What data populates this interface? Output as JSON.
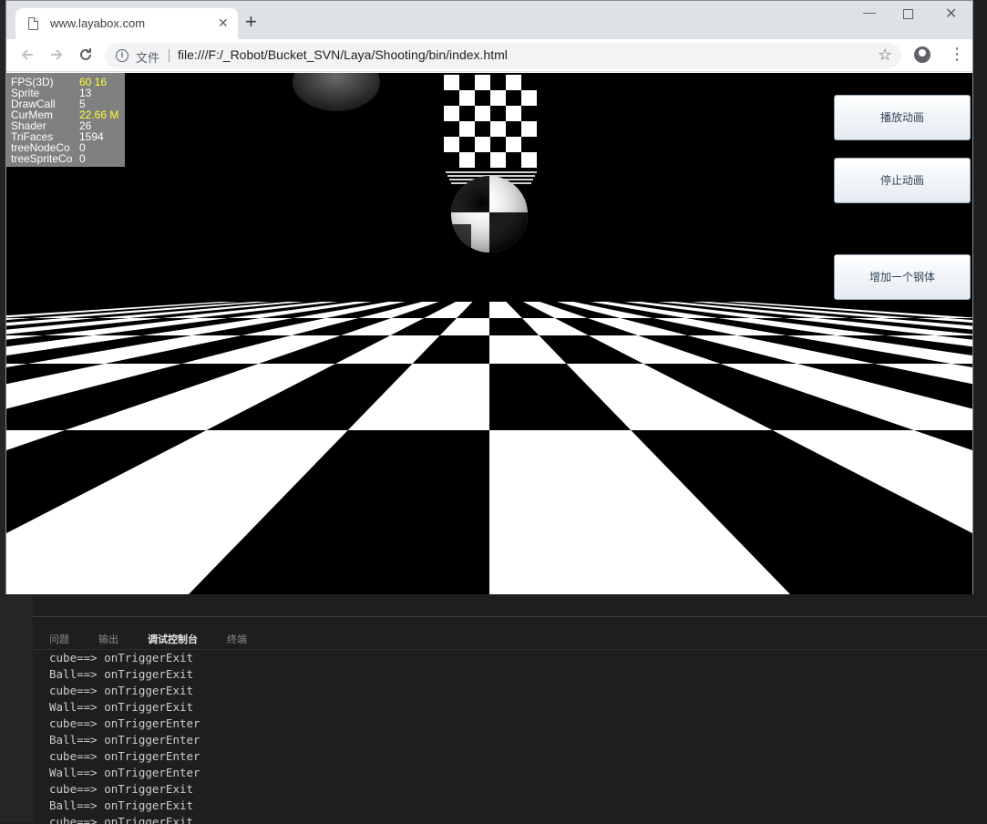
{
  "browser": {
    "tab_title": "www.layabox.com",
    "tab_close": "✕",
    "new_tab": "+",
    "address": {
      "security_label": "文件",
      "url": "file:///F:/_Robot/Bucket_SVN/Laya/Shooting/bin/index.html"
    },
    "icons": {
      "back": "arrow-left-icon",
      "forward": "arrow-right-icon",
      "reload": "reload-icon",
      "star": "star-icon",
      "profile": "account-icon",
      "menu": "menu-dots-icon"
    }
  },
  "stats": [
    {
      "label": "FPS(3D)",
      "value": "60 16",
      "highlight": true
    },
    {
      "label": "Sprite",
      "value": "13",
      "highlight": false
    },
    {
      "label": "DrawCall",
      "value": "5",
      "highlight": false
    },
    {
      "label": "CurMem",
      "value": "22.66 M",
      "highlight": true
    },
    {
      "label": "Shader",
      "value": "26",
      "highlight": false
    },
    {
      "label": "TriFaces",
      "value": "1594",
      "highlight": false
    },
    {
      "label": "treeNodeCo",
      "value": "0",
      "highlight": false
    },
    {
      "label": "treeSpriteCo",
      "value": "0",
      "highlight": false
    }
  ],
  "buttons": {
    "play": "播放动画",
    "stop": "停止动画",
    "add_body": "增加一个钢体"
  },
  "panel": {
    "tabs": [
      "问题",
      "输出",
      "调试控制台",
      "终端"
    ],
    "active_tab": "调试控制台",
    "console": [
      "cube==> onTriggerExit",
      "Ball==> onTriggerExit",
      "cube==> onTriggerExit",
      "Wall==> onTriggerExit",
      "cube==> onTriggerEnter",
      "Ball==> onTriggerEnter",
      "cube==> onTriggerEnter",
      "Wall==> onTriggerEnter",
      "cube==> onTriggerExit",
      "Ball==> onTriggerExit",
      "cube==> onTriggerExit"
    ]
  },
  "colors": {
    "stat_highlight": "#ffff33",
    "canvas_bg": "#000000",
    "vscode_bg": "#1e1e1e"
  }
}
